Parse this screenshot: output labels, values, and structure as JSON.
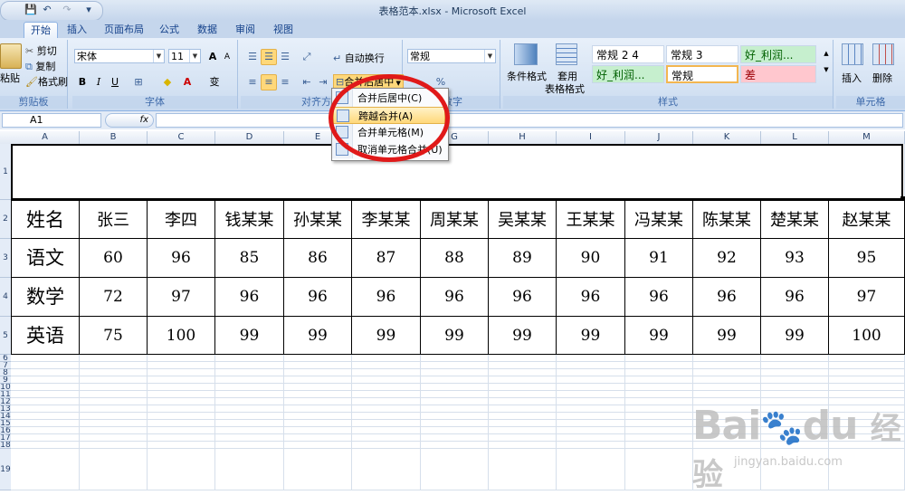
{
  "window": {
    "title": "表格范本.xlsx - Microsoft Excel"
  },
  "qat": {
    "save": "💾",
    "undo": "↶",
    "redo": "↷",
    "more": "▾"
  },
  "tabs": [
    "开始",
    "插入",
    "页面布局",
    "公式",
    "数据",
    "审阅",
    "视图"
  ],
  "active_tab": "开始",
  "clipboard": {
    "paste": "粘贴",
    "cut": "剪切",
    "copy": "复制",
    "format_painter": "格式刷",
    "label": "剪贴板"
  },
  "font": {
    "name": "宋体",
    "size": "11",
    "grow": "A",
    "shrink": "A",
    "bold": "B",
    "italic": "I",
    "underline": "U",
    "border": "⊞",
    "fill": "◆",
    "color": "A",
    "phonetic": "变",
    "label": "字体"
  },
  "alignment": {
    "wrap": "自动换行",
    "merge": "合并后居中",
    "label": "对齐方式"
  },
  "number": {
    "format": "常规",
    "percent": "%",
    "label": "数字"
  },
  "styles": {
    "conditional": "条件格式",
    "table_format_1": "套用",
    "table_format_2": "表格格式",
    "cells": [
      "常规 2 4",
      "常规 3",
      "好_利润...",
      "好_利润...",
      "常规",
      "差"
    ],
    "label": "样式"
  },
  "cells_group": {
    "insert": "插入",
    "delete": "删除",
    "label": "单元格"
  },
  "formula_bar": {
    "name_box": "A1",
    "fx": "fx",
    "value": ""
  },
  "columns": [
    "A",
    "B",
    "C",
    "D",
    "E",
    "F",
    "G",
    "H",
    "I",
    "J",
    "K",
    "L",
    "M"
  ],
  "row_numbers": [
    "1",
    "2",
    "3",
    "4",
    "5",
    "6",
    "7",
    "8",
    "9",
    "10",
    "11",
    "12",
    "13",
    "14",
    "15",
    "16",
    "17",
    "18",
    "19"
  ],
  "table": {
    "headers": [
      "姓名",
      "张三",
      "李四",
      "钱某某",
      "孙某某",
      "李某某",
      "周某某",
      "吴某某",
      "王某某",
      "冯某某",
      "陈某某",
      "楚某某",
      "赵某某"
    ],
    "rows": [
      [
        "语文",
        "60",
        "96",
        "85",
        "86",
        "87",
        "88",
        "89",
        "90",
        "91",
        "92",
        "93",
        "95"
      ],
      [
        "数学",
        "72",
        "97",
        "96",
        "96",
        "96",
        "96",
        "96",
        "96",
        "96",
        "96",
        "96",
        "97"
      ],
      [
        "英语",
        "75",
        "100",
        "99",
        "99",
        "99",
        "99",
        "99",
        "99",
        "99",
        "99",
        "99",
        "100"
      ]
    ]
  },
  "merge_menu": {
    "items": [
      "合并后居中(C)",
      "跨越合并(A)",
      "合并单元格(M)",
      "取消单元格合并(U)"
    ],
    "highlighted": "跨越合并(A)"
  },
  "watermark": {
    "brand": "Bai",
    "brand2": "du",
    "cn": "经验",
    "url": "jingyan.baidu.com"
  },
  "colors": {
    "accent": "#15428b",
    "highlight_circle": "#e01919",
    "good": "#c6efce",
    "bad": "#ffc7ce"
  }
}
